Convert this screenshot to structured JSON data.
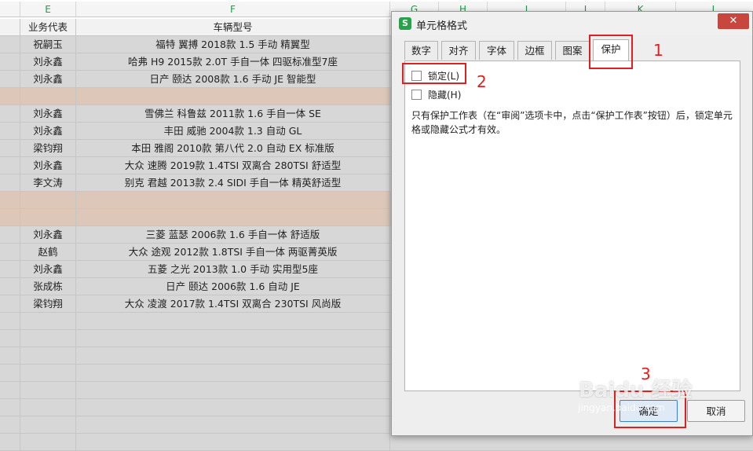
{
  "sheet": {
    "column_headers": {
      "E": "E",
      "F": "F",
      "G": "G",
      "H": "H",
      "I": "I",
      "J": "J",
      "K": "K",
      "L": "L"
    },
    "header_row": {
      "agent": "业务代表",
      "model": "车辆型号"
    },
    "rows": [
      {
        "agent": "祝嗣玉",
        "model": "福特 翼搏 2018款  1.5 手动 精翼型",
        "highlight": false
      },
      {
        "agent": "刘永鑫",
        "model": "哈弗 H9 2015款  2.0T 手自一体 四驱标准型7座",
        "highlight": false
      },
      {
        "agent": "刘永鑫",
        "model": "日产 颐达 2008款  1.6 手动 JE 智能型",
        "highlight": false
      },
      {
        "agent": "",
        "model": "",
        "highlight": true
      },
      {
        "agent": "刘永鑫",
        "model": "雪佛兰 科鲁兹 2011款  1.6 手自一体 SE",
        "highlight": false
      },
      {
        "agent": "刘永鑫",
        "model": "丰田 威驰 2004款  1.3 自动 GL",
        "highlight": false
      },
      {
        "agent": "梁钧翔",
        "model": "本田 雅阁 2010款 第八代 2.0 自动 EX 标准版",
        "highlight": false
      },
      {
        "agent": "刘永鑫",
        "model": "大众 速腾 2019款  1.4TSI 双离合 280TSI 舒适型",
        "highlight": false
      },
      {
        "agent": "李文涛",
        "model": "别克 君越 2013款  2.4 SIDI 手自一体 精英舒适型",
        "highlight": false
      },
      {
        "agent": "",
        "model": "",
        "highlight": true
      },
      {
        "agent": "",
        "model": "",
        "highlight": true
      },
      {
        "agent": "刘永鑫",
        "model": "三菱 蓝瑟 2006款  1.6 手自一体 舒适版",
        "highlight": false
      },
      {
        "agent": "赵鹤",
        "model": "大众 途观 2012款  1.8TSI 手自一体 两驱菁英版",
        "highlight": false
      },
      {
        "agent": "刘永鑫",
        "model": "五菱 之光 2013款  1.0 手动 实用型5座",
        "highlight": false
      },
      {
        "agent": "张成栋",
        "model": "日产 颐达 2006款  1.6 自动 JE",
        "highlight": false
      },
      {
        "agent": "梁钧翔",
        "model": "大众 凌渡 2017款  1.4TSI 双离合 230TSI 风尚版",
        "highlight": false
      },
      {
        "agent": "",
        "model": "",
        "highlight": false
      },
      {
        "agent": "",
        "model": "",
        "highlight": false
      },
      {
        "agent": "",
        "model": "",
        "highlight": false
      },
      {
        "agent": "",
        "model": "",
        "highlight": false
      },
      {
        "agent": "",
        "model": "",
        "highlight": false
      },
      {
        "agent": "",
        "model": "",
        "highlight": false
      },
      {
        "agent": "",
        "model": "",
        "highlight": false
      },
      {
        "agent": "",
        "model": "",
        "highlight": false
      }
    ]
  },
  "dialog": {
    "app_icon": "S",
    "title": "单元格格式",
    "close_label": "✕",
    "tabs": [
      {
        "label": "数字"
      },
      {
        "label": "对齐"
      },
      {
        "label": "字体"
      },
      {
        "label": "边框"
      },
      {
        "label": "图案"
      },
      {
        "label": "保护",
        "active": true
      }
    ],
    "lock_label": "锁定(L)",
    "lock_checked": false,
    "hide_label": "隐藏(H)",
    "hide_checked": false,
    "description": "只有保护工作表（在“审阅”选项卡中，点击“保护工作表”按钮）后，锁定单元格或隐藏公式才有效。",
    "ok_label": "确定",
    "cancel_label": "取消"
  },
  "annotations": {
    "n1": "1",
    "n2": "2",
    "n3": "3"
  },
  "watermark": {
    "text": "Baidu 经验",
    "sub": "jingyan.baidu.com"
  },
  "colors": {
    "header_green": "#1e9a4a",
    "highlight_row": "#dcc7b8",
    "annotation_red": "#e02020",
    "cell_gray": "#d7d7d7"
  }
}
